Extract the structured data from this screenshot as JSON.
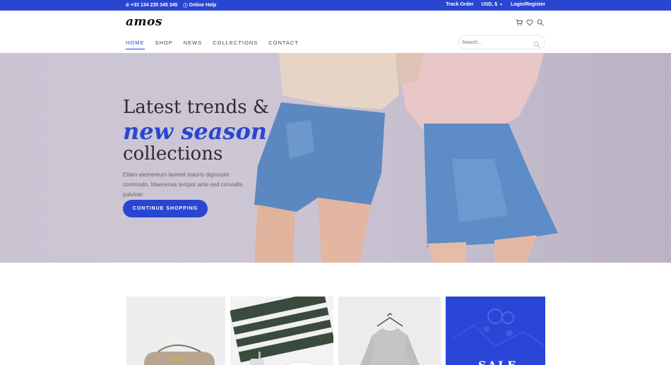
{
  "topbar": {
    "phone": "+33 134 235 345 345",
    "help": "Online Help",
    "track": "Track Order",
    "currency": "USD, $",
    "login": "Login/Register"
  },
  "header": {
    "logo": "amos",
    "nav": [
      {
        "label": "HOME",
        "active": true
      },
      {
        "label": "SHOP",
        "active": false
      },
      {
        "label": "NEWS",
        "active": false
      },
      {
        "label": "COLLECTIONS",
        "active": false
      },
      {
        "label": "CONTACT",
        "active": false
      }
    ],
    "search_placeholder": "Search...",
    "icons": [
      "cart-icon",
      "heart-icon",
      "search-icon"
    ]
  },
  "hero": {
    "line1": "Latest trends &",
    "line2": "new season",
    "line3": "collections",
    "text": "Etiam elementum laoreet mauris dignissim commodo. Maecenas tempor ante sed convallis pulvinar.",
    "button": "CONTINUE SHOPPING"
  },
  "products": {
    "sale_text": "SALE"
  },
  "colors": {
    "accent": "#2946d0",
    "hero_bg": "#cac4d3"
  }
}
